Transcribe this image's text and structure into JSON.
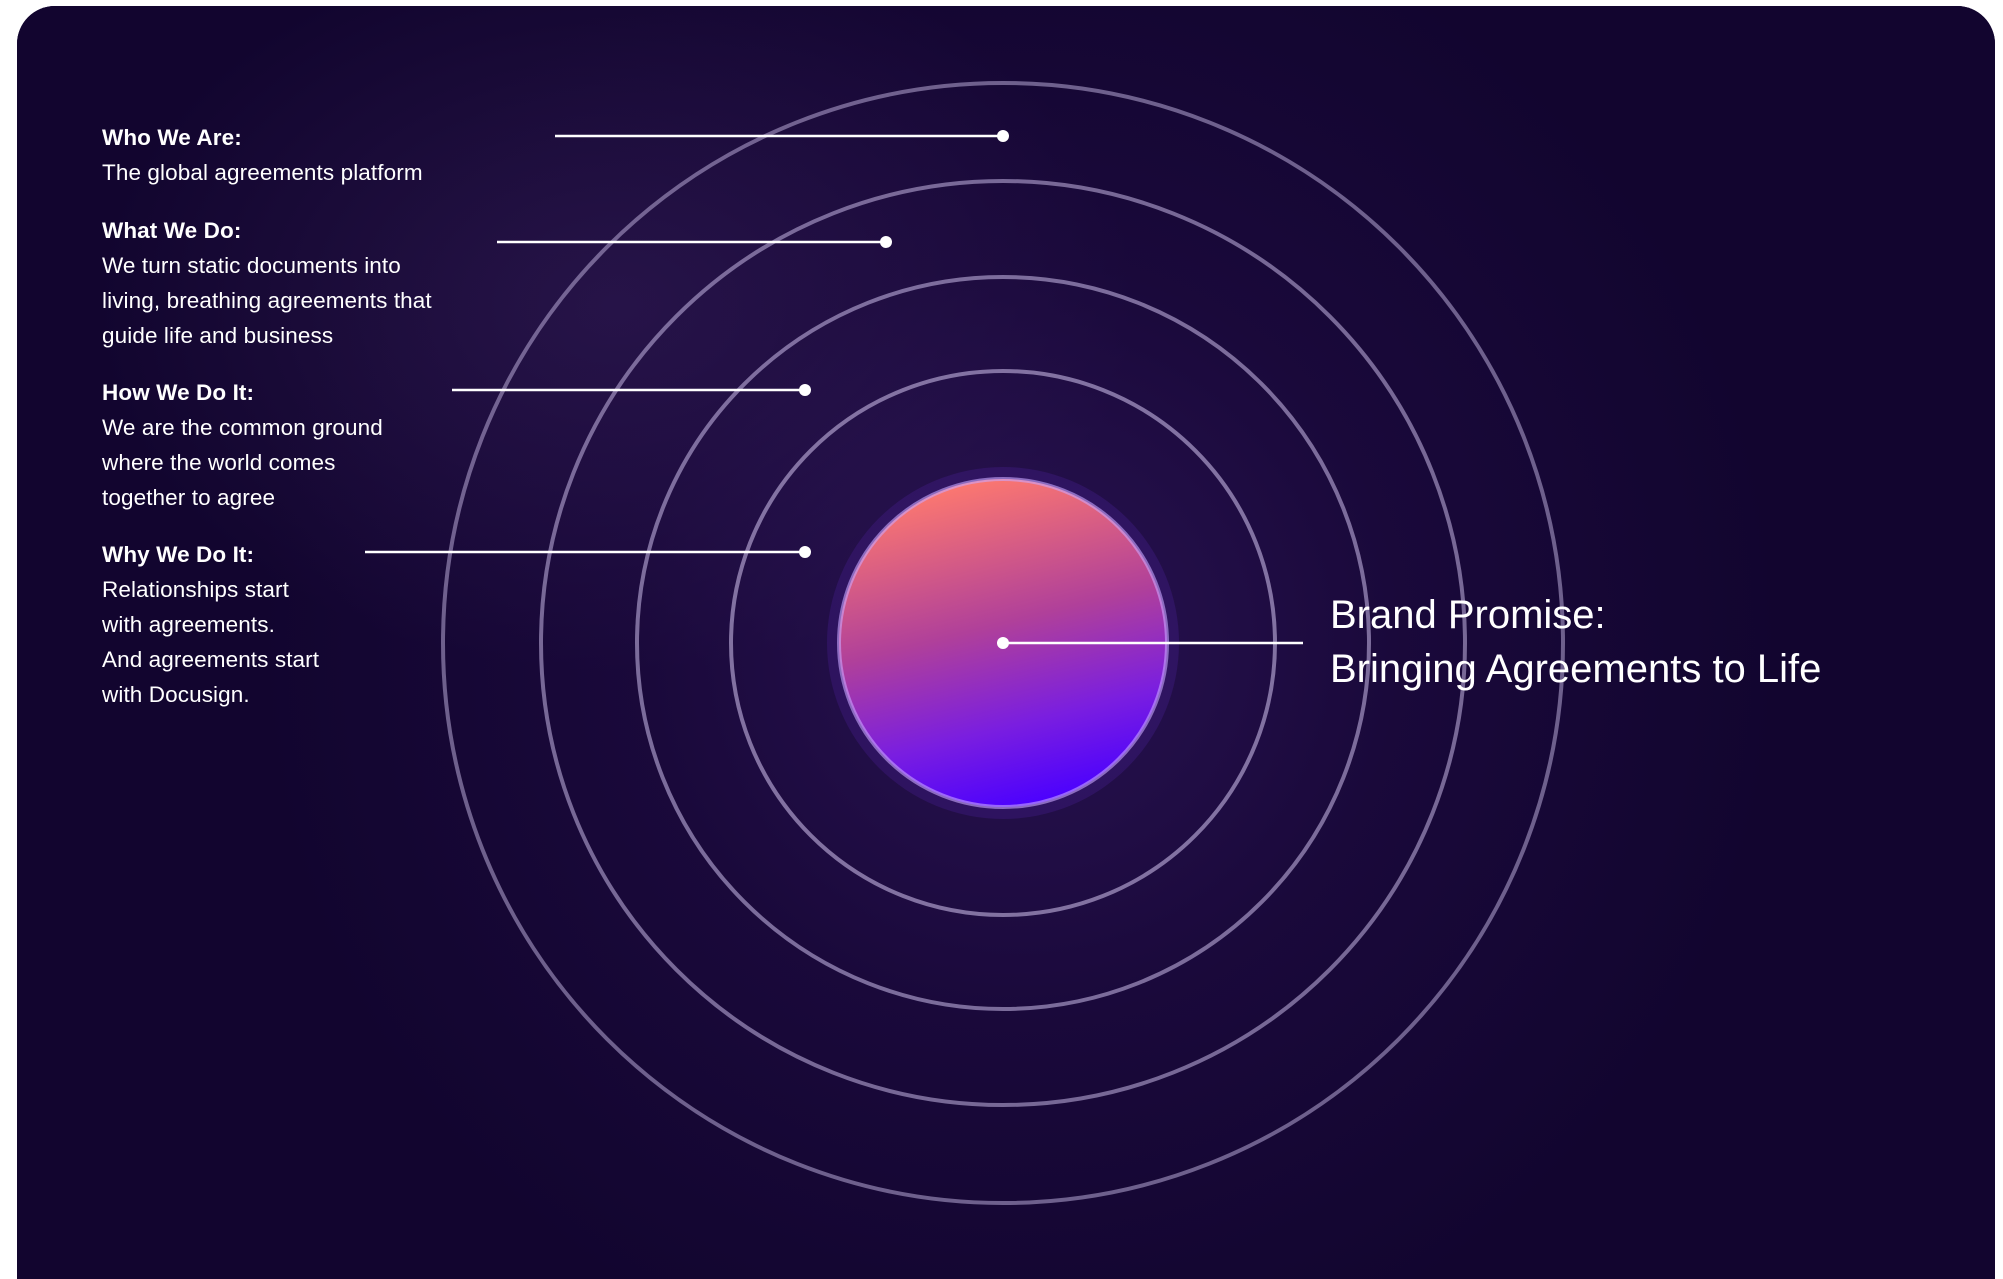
{
  "layers": [
    {
      "heading": "Who We Are:",
      "text": "The global agreements platform"
    },
    {
      "heading": "What We Do:",
      "text": "We turn static documents into\nliving, breathing agreements that\nguide life and business"
    },
    {
      "heading": "How We Do It:",
      "text": "We are the common ground\nwhere the world comes\ntogether to agree"
    },
    {
      "heading": "Why We Do It:",
      "text": "Relationships start\nwith agreements.\nAnd agreements start\nwith Docusign."
    }
  ],
  "core": {
    "line1": "Brand Promise:",
    "line2": "Bringing Agreements to Life"
  },
  "colors": {
    "background": "#12052f",
    "ring": "#b8a9d6",
    "core_top": "#ff7a6e",
    "core_bottom": "#4a00ff",
    "text": "#ffffff"
  }
}
